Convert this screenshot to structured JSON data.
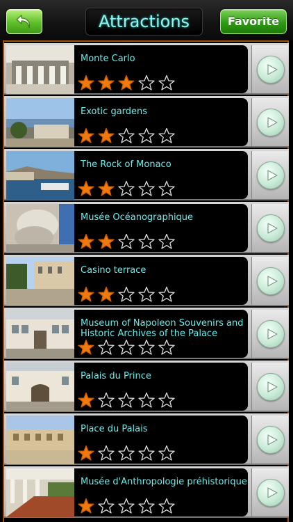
{
  "header": {
    "back_icon": "back-arrow-icon",
    "title": "Attractions",
    "favorite_label": "Favorite"
  },
  "colors": {
    "accent_cyan": "#5ff2f0",
    "star_filled": "#f07a10",
    "frame_orange": "#a24d10",
    "button_green": "#2f9a16"
  },
  "attractions": [
    {
      "name": "Monte Carlo",
      "rating": 3,
      "max_rating": 5,
      "thumb": "monte-carlo-photo"
    },
    {
      "name": "Exotic gardens",
      "rating": 2,
      "max_rating": 5,
      "thumb": "exotic-gardens-photo"
    },
    {
      "name": "The Rock of Monaco",
      "rating": 2,
      "max_rating": 5,
      "thumb": "rock-of-monaco-photo"
    },
    {
      "name": "Musée Océanographique",
      "rating": 2,
      "max_rating": 5,
      "thumb": "musee-oceanographique-photo"
    },
    {
      "name": "Casino terrace",
      "rating": 2,
      "max_rating": 5,
      "thumb": "casino-terrace-photo"
    },
    {
      "name": "Museum of Napoleon Souvenirs and Historic Archives of the Palace",
      "rating": 1,
      "max_rating": 5,
      "thumb": "napoleon-museum-photo"
    },
    {
      "name": "Palais du Prince",
      "rating": 1,
      "max_rating": 5,
      "thumb": "palais-du-prince-photo"
    },
    {
      "name": "Place du Palais",
      "rating": 1,
      "max_rating": 5,
      "thumb": "place-du-palais-photo"
    },
    {
      "name": "Musée d'Anthropologie préhistorique",
      "rating": 1,
      "max_rating": 5,
      "thumb": "musee-anthropologie-photo"
    }
  ]
}
